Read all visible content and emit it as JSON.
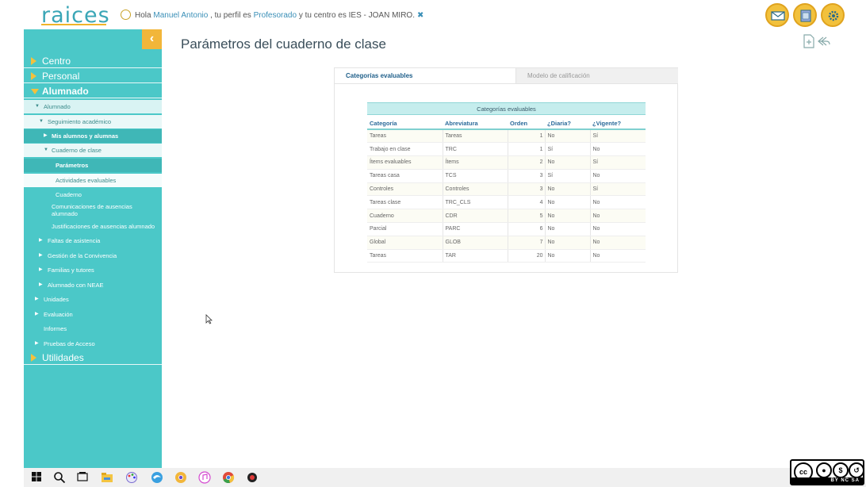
{
  "header": {
    "logo": "raices",
    "greeting_prefix": "Hola ",
    "user_name": "Manuel Antonio",
    "greeting_mid": " , tu perfil es ",
    "profile": "Profesorado",
    "greeting_suffix": " y tu centro es IES - JOAN MIRO.",
    "icons": [
      "mail-icon",
      "documents-icon",
      "settings-icon"
    ]
  },
  "sidebar": {
    "sections": {
      "centro": "Centro",
      "personal": "Personal",
      "alumnado": "Alumnado",
      "utilidades": "Utilidades"
    },
    "items": {
      "alumnado": "Alumnado",
      "seguimiento": "Seguimiento académico",
      "mis_alumnos": "Mis alumnos y alumnas",
      "cuaderno_clase": "Cuaderno de clase",
      "parametros": "Parámetros",
      "actividades": "Actividades evaluables",
      "cuaderno": "Cuaderno",
      "comunicaciones": "Comunicaciones de ausencias alumnado",
      "justificaciones": "Justificaciones de ausencias alumnado",
      "faltas": "Faltas de asistencia",
      "convivencia": "Gestión de la Convivencia",
      "familias": "Familias y tutores",
      "neae": "Alumnado con NEAE",
      "unidades": "Unidades",
      "evaluacion": "Evaluación",
      "informes": "Informes",
      "pruebas": "Pruebas de Acceso"
    }
  },
  "main": {
    "title": "Parámetros del cuaderno de clase",
    "tabs": [
      "Categorías evaluables",
      "Modelo de calificación"
    ],
    "table_title": "Categorías evaluables",
    "columns": [
      "Categoría",
      "Abreviatura",
      "Orden",
      "¿Diaria?",
      "¿Vigente?"
    ],
    "rows": [
      [
        "Tareas",
        "Tareas",
        "1",
        "No",
        "Sí"
      ],
      [
        "Trabajo en clase",
        "TRC",
        "1",
        "Sí",
        "No"
      ],
      [
        "Ítems evaluables",
        "Ítems",
        "2",
        "No",
        "Sí"
      ],
      [
        "Tareas casa",
        "TCS",
        "3",
        "Sí",
        "No"
      ],
      [
        "Controles",
        "Controles",
        "3",
        "No",
        "Sí"
      ],
      [
        "Tareas clase",
        "TRC_CLS",
        "4",
        "No",
        "No"
      ],
      [
        "Cuaderno",
        "CDR",
        "5",
        "No",
        "No"
      ],
      [
        "Parcial",
        "PARC",
        "6",
        "No",
        "No"
      ],
      [
        "Global",
        "GLOB",
        "7",
        "No",
        "No"
      ],
      [
        "Tareas",
        "TAR",
        "20",
        "No",
        "No"
      ]
    ]
  },
  "license": {
    "cc": "cc",
    "label": "BY NC SA"
  },
  "colors": {
    "sidebar": "#4bc8c8",
    "accent": "#f2b63a",
    "title": "#3a4e5a"
  }
}
